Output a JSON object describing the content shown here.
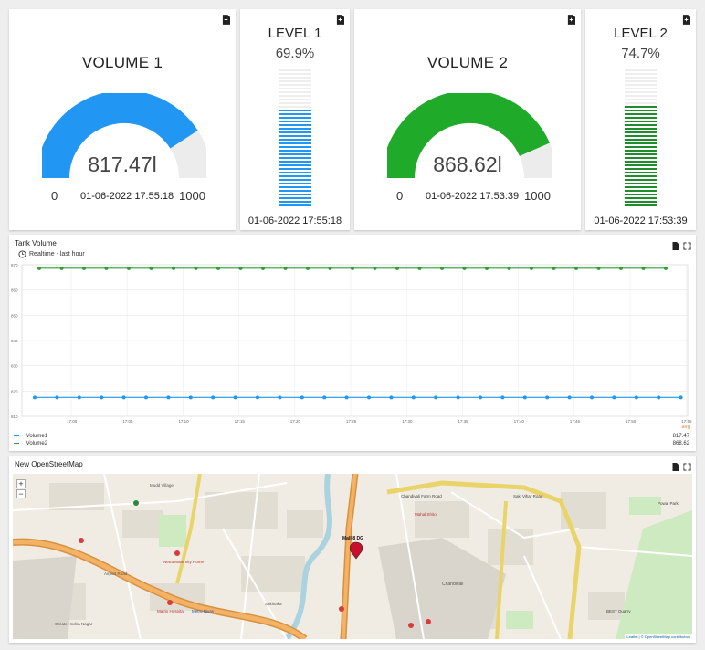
{
  "gauges": [
    {
      "title": "VOLUME 1",
      "value_text": "817.47l",
      "value": 817.47,
      "min_label": "0",
      "max_label": "1000",
      "min": 0,
      "max": 1000,
      "timestamp": "01-06-2022 17:55:18",
      "color": "#2196f3"
    },
    {
      "title": "VOLUME 2",
      "value_text": "868.62l",
      "value": 868.62,
      "min_label": "0",
      "max_label": "1000",
      "min": 0,
      "max": 1000,
      "timestamp": "01-06-2022 17:53:39",
      "color": "#1faa2a"
    }
  ],
  "levels": [
    {
      "title": "LEVEL 1",
      "percent_text": "69.9%",
      "percent": 69.9,
      "timestamp": "01-06-2022 17:55:18",
      "color": "#2196f3"
    },
    {
      "title": "LEVEL 2",
      "percent_text": "74.7%",
      "percent": 74.7,
      "timestamp": "01-06-2022 17:53:39",
      "color": "#1e8e2a"
    }
  ],
  "chart_panel": {
    "title": "Tank Volume",
    "timewindow": "Realtime - last hour",
    "avg_header": "avg"
  },
  "chart_data": {
    "type": "line",
    "y_ticks": [
      "870",
      "860",
      "850",
      "840",
      "830",
      "820",
      "810"
    ],
    "ylim": [
      810,
      870
    ],
    "x_ticks": [
      "17:00",
      "17:05",
      "17:10",
      "17:15",
      "17:20",
      "17:25",
      "17:30",
      "17:35",
      "17:40",
      "17:45",
      "17:50",
      "17:55"
    ],
    "grid": true,
    "legend_position": "bottom",
    "series": [
      {
        "name": "Volume1",
        "color": "#2196f3",
        "value": 817.47,
        "avg": "817.47",
        "points": 30
      },
      {
        "name": "Volume2",
        "color": "#2e9e34",
        "value": 868.62,
        "avg": "868.62",
        "points": 29
      }
    ]
  },
  "map_panel": {
    "title": "New OpenStreetMap",
    "zoom_in": "+",
    "zoom_out": "−",
    "labels": [
      "Mudd Village",
      "Airport Road",
      "Netra Maternity Home",
      "Matrix Hospital",
      "Sakinaka",
      "Metro Nivas",
      "Greater Indira Nagar",
      "Mahal Shitol",
      "Mall-8 DG",
      "Chandivali",
      "Chandivali Farm Road",
      "Saki Vihar Road",
      "Powai Park",
      "BEST Quarry"
    ],
    "attribution": "Leaflet | © OpenStreetMap contributors"
  }
}
